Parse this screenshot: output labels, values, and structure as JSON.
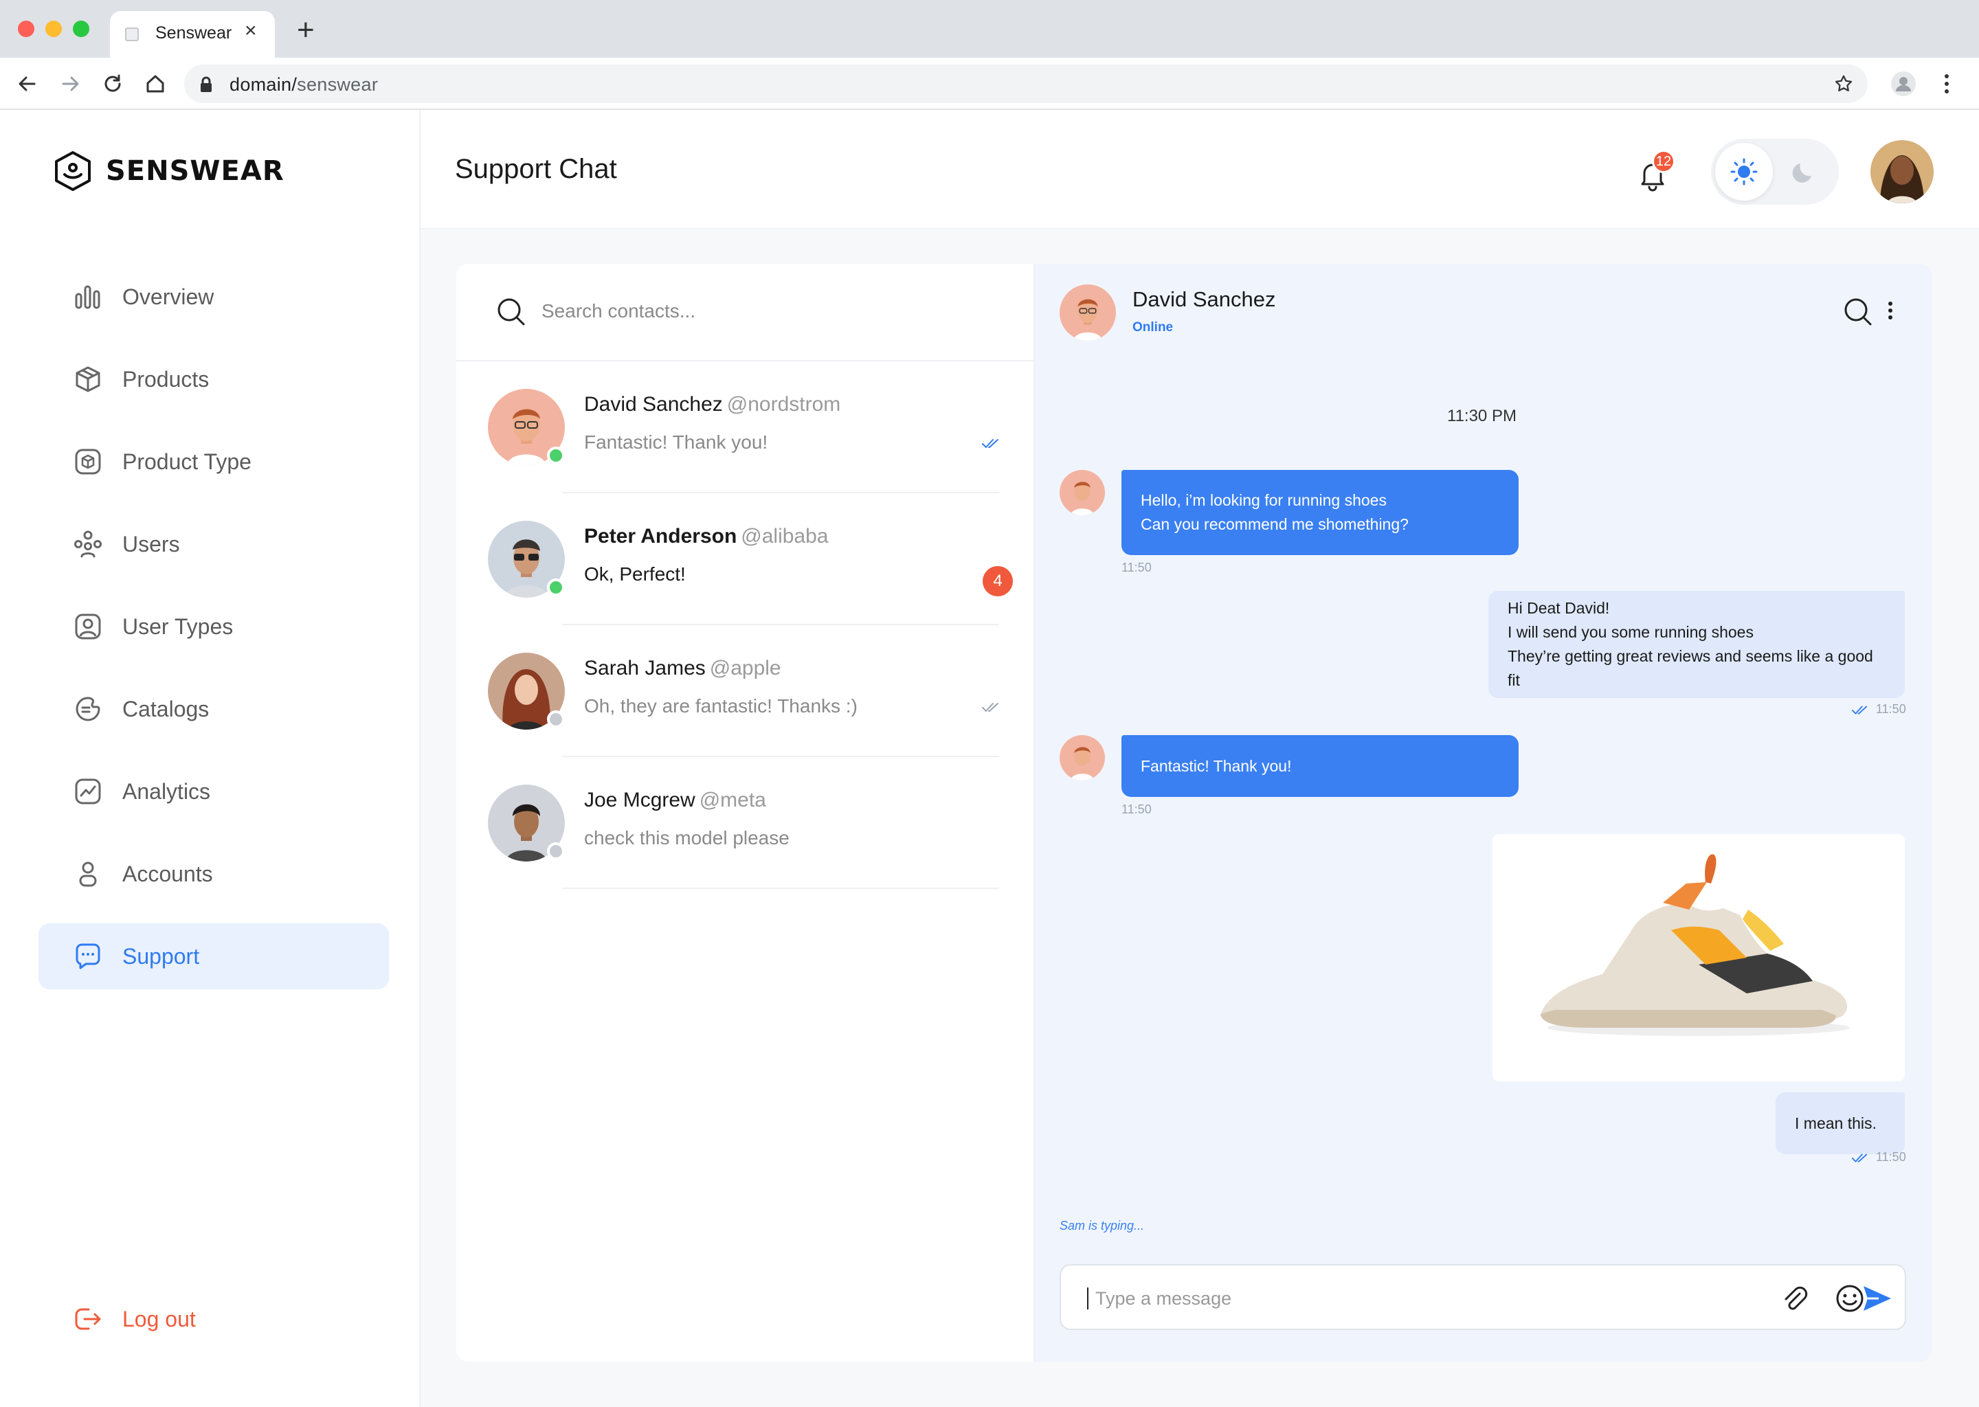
{
  "browser": {
    "tab_title": "Senswear",
    "url_domain": "domain/",
    "url_path": "senswear"
  },
  "sidebar": {
    "brand": "SENSWEAR",
    "items": [
      {
        "label": "Overview",
        "icon": "bar-chart-icon"
      },
      {
        "label": "Products",
        "icon": "box-icon"
      },
      {
        "label": "Product Type",
        "icon": "package-type-icon"
      },
      {
        "label": "Users",
        "icon": "users-icon"
      },
      {
        "label": "User Types",
        "icon": "user-card-icon"
      },
      {
        "label": "Catalogs",
        "icon": "catalog-icon"
      },
      {
        "label": "Analytics",
        "icon": "analytics-icon"
      },
      {
        "label": "Accounts",
        "icon": "account-icon"
      },
      {
        "label": "Support",
        "icon": "chat-bubble-icon",
        "active": true
      }
    ],
    "logout_label": "Log out"
  },
  "header": {
    "title": "Support Chat",
    "notification_count": "12"
  },
  "contacts": {
    "search_placeholder": "Search contacts...",
    "list": [
      {
        "name": "David Sanchez",
        "handle": "@nordstrom",
        "message": "Fantastic! Thank you!",
        "online": true,
        "read": true
      },
      {
        "name": "Peter Anderson",
        "handle": "@alibaba",
        "message": "Ok, Perfect!",
        "online": true,
        "unread": "4"
      },
      {
        "name": "Sarah James",
        "handle": "@apple",
        "message": "Oh, they are fantastic! Thanks :)",
        "online": false,
        "read": true
      },
      {
        "name": "Joe Mcgrew",
        "handle": "@meta",
        "message": "check this model please",
        "online": false
      }
    ]
  },
  "chat": {
    "contact_name": "David Sanchez",
    "contact_status": "Online",
    "timestamp": "11:30 PM",
    "messages": [
      {
        "from": "them",
        "lines": [
          "Hello, i’m looking for running shoes",
          "Can you recommend me shomething?"
        ],
        "time": "11:50"
      },
      {
        "from": "me",
        "lines": [
          "Hi Deat David!",
          "I will send you some running shoes",
          "They’re getting great reviews and seems like a good fit"
        ],
        "time": "11:50"
      },
      {
        "from": "them",
        "lines": [
          "Fantastic! Thank you!"
        ],
        "time": "11:50"
      },
      {
        "from": "me",
        "type": "image",
        "alt": "running shoe"
      },
      {
        "from": "me",
        "lines": [
          "I mean this."
        ],
        "time": "11:50"
      }
    ],
    "typing_text": "Sam is typing...",
    "composer_placeholder": "Type a message"
  },
  "colors": {
    "accent": "#3a80f2",
    "danger": "#f0593b",
    "online": "#4cd06a",
    "offline": "#c8ccd2"
  }
}
